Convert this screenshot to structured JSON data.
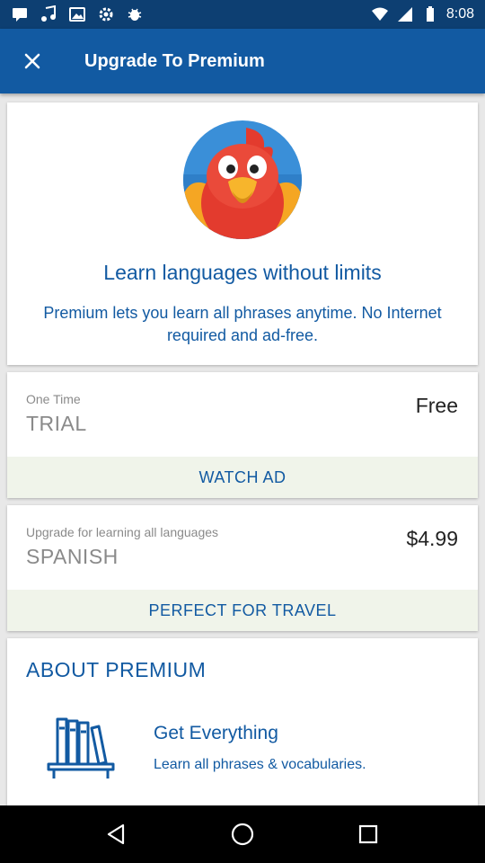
{
  "status_bar": {
    "time": "8:08",
    "left_icons": [
      "message-icon",
      "music-icon",
      "image-icon",
      "settings-icon",
      "bug-icon"
    ],
    "right_icons": [
      "wifi-icon",
      "signal-icon",
      "battery-icon"
    ]
  },
  "toolbar": {
    "title": "Upgrade To Premium",
    "close_icon": "close-icon"
  },
  "hero": {
    "title": "Learn languages without limits",
    "description": "Premium lets you learn all phrases anytime. No Internet required and ad-free."
  },
  "plans": [
    {
      "subtitle": "One Time",
      "name": "TRIAL",
      "price": "Free",
      "action": "WATCH AD"
    },
    {
      "subtitle": "Upgrade for learning all languages",
      "name": "SPANISH",
      "price": "$4.99",
      "action": "PERFECT FOR TRAVEL"
    }
  ],
  "about": {
    "title": "ABOUT PREMIUM",
    "feature_title": "Get Everything",
    "feature_desc": "Learn all phrases & vocabularies."
  },
  "nav": [
    "back-icon",
    "home-icon",
    "recents-icon"
  ],
  "colors": {
    "status_bar": "#0d3f72",
    "toolbar": "#125aa2",
    "accent_text": "#125aa2",
    "action_bg": "#f0f4ea"
  }
}
